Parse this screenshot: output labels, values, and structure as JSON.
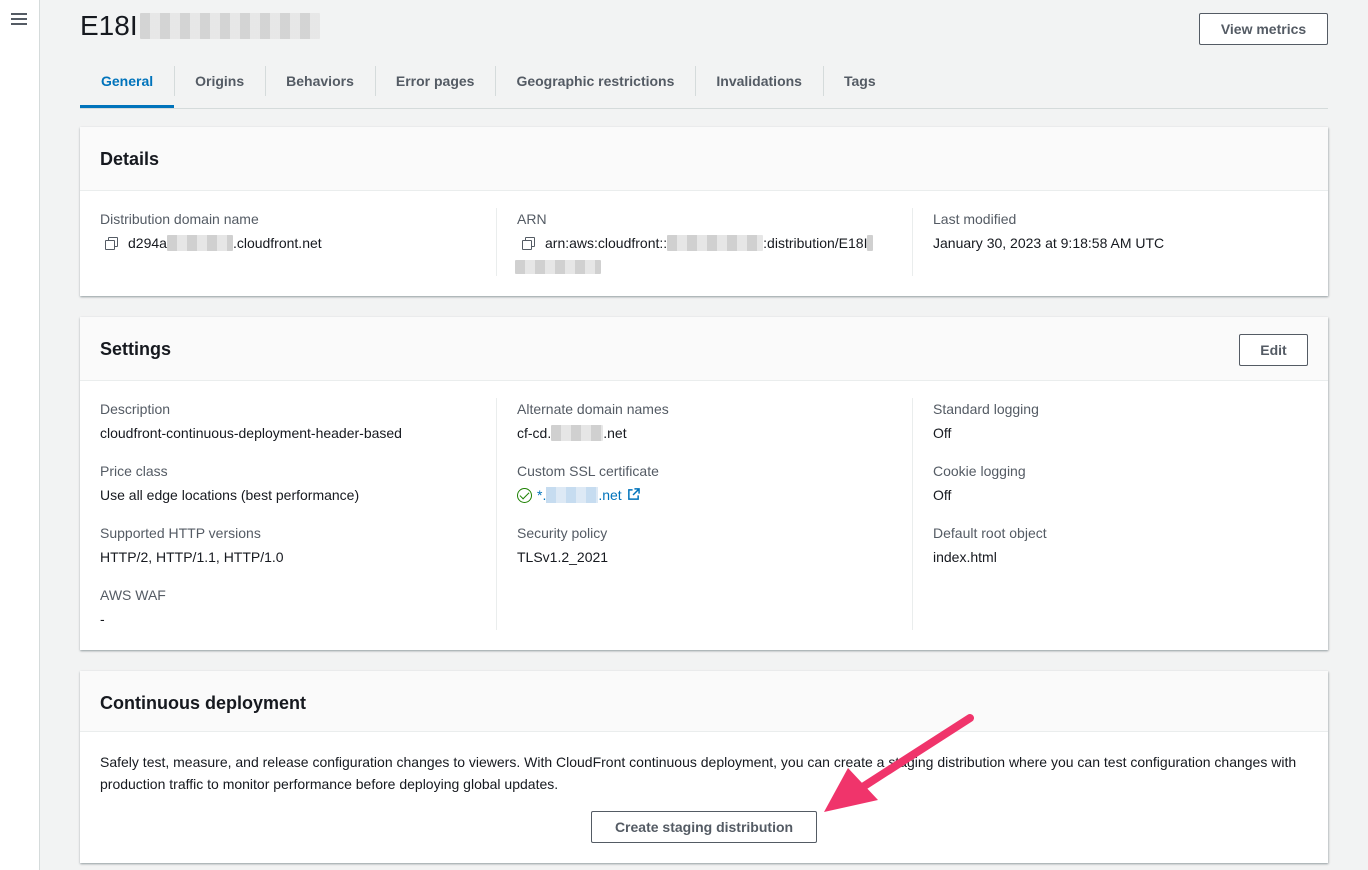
{
  "page": {
    "title_prefix": "E18I",
    "view_metrics_label": "View metrics"
  },
  "tabs": [
    {
      "label": "General"
    },
    {
      "label": "Origins"
    },
    {
      "label": "Behaviors"
    },
    {
      "label": "Error pages"
    },
    {
      "label": "Geographic restrictions"
    },
    {
      "label": "Invalidations"
    },
    {
      "label": "Tags"
    }
  ],
  "details": {
    "heading": "Details",
    "domain": {
      "label": "Distribution domain name",
      "value_prefix": "d294a",
      "value_suffix": ".cloudfront.net"
    },
    "arn": {
      "label": "ARN",
      "value_prefix": "arn:aws:cloudfront::",
      "value_mid": ":distribution/E18I"
    },
    "modified": {
      "label": "Last modified",
      "value": "January 30, 2023 at 9:18:58 AM UTC"
    }
  },
  "settings": {
    "heading": "Settings",
    "edit_label": "Edit",
    "description": {
      "label": "Description",
      "value": "cloudfront-continuous-deployment-header-based"
    },
    "price_class": {
      "label": "Price class",
      "value": "Use all edge locations (best performance)"
    },
    "http_versions": {
      "label": "Supported HTTP versions",
      "value": "HTTP/2, HTTP/1.1, HTTP/1.0"
    },
    "waf": {
      "label": "AWS WAF",
      "value": "-"
    },
    "alt_domains": {
      "label": "Alternate domain names",
      "value_prefix": "cf-cd.",
      "value_suffix": ".net"
    },
    "ssl_cert": {
      "label": "Custom SSL certificate",
      "value_prefix": "*.",
      "value_suffix": ".net"
    },
    "security_policy": {
      "label": "Security policy",
      "value": "TLSv1.2_2021"
    },
    "std_logging": {
      "label": "Standard logging",
      "value": "Off"
    },
    "cookie_logging": {
      "label": "Cookie logging",
      "value": "Off"
    },
    "root_object": {
      "label": "Default root object",
      "value": "index.html"
    }
  },
  "continuous": {
    "heading": "Continuous deployment",
    "description": "Safely test, measure, and release configuration changes to viewers. With CloudFront continuous deployment, you can create a staging distribution where you can test configuration changes with production traffic to monitor performance before deploying global updates.",
    "button_label": "Create staging distribution"
  },
  "colors": {
    "accent": "#0073bb",
    "annotation_arrow": "#f0346b",
    "success": "#1d8102"
  }
}
